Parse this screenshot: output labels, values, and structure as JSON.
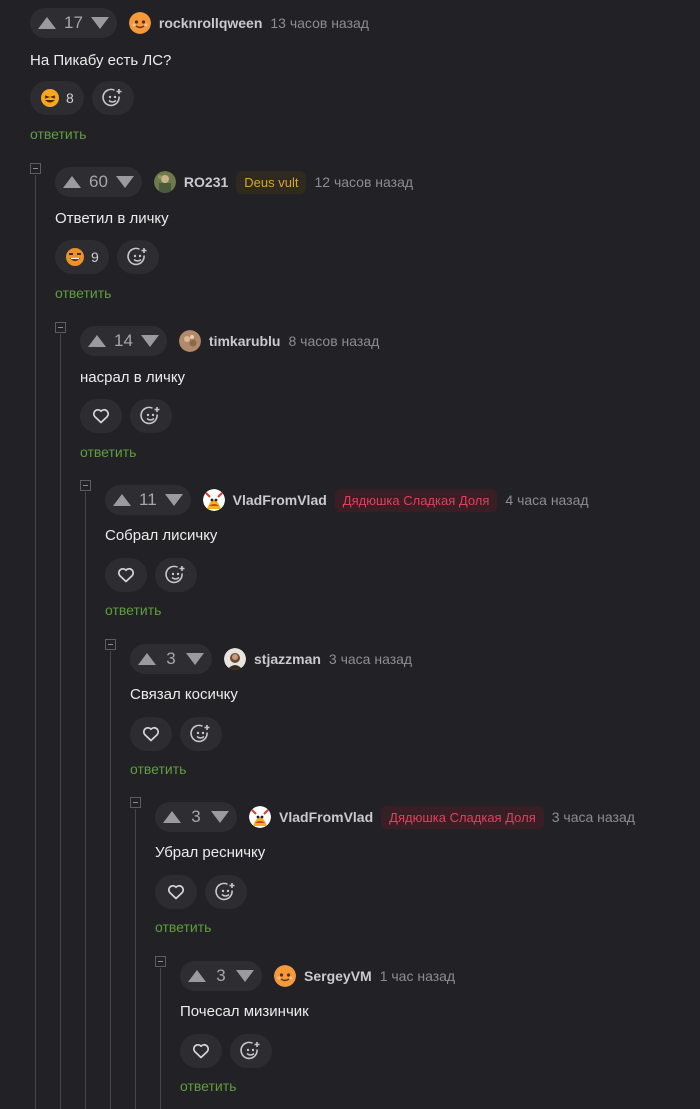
{
  "reply_label": "ответить",
  "colors": {
    "background": "#222226",
    "reply_link": "#5f9e3f",
    "badge_gold": "#d8a72c",
    "badge_red": "#e0405b"
  },
  "comments": [
    {
      "rating": "17",
      "username": "rocknrollqween",
      "badge": "",
      "time": "13 часов назад",
      "text": "На Пикабу есть ЛС?",
      "reaction": {
        "icon": "laughing-emoji-icon",
        "count": "8"
      },
      "avatar_icon": "peach-face-avatar"
    },
    {
      "rating": "60",
      "username": "RO231",
      "badge": "Deus vult",
      "time": "12 часов назад",
      "text": "Ответил в личку",
      "reaction": {
        "icon": "grinning-emoji-icon",
        "count": "9"
      },
      "avatar_icon": "photo-avatar"
    },
    {
      "rating": "14",
      "username": "timkarublu",
      "badge": "",
      "time": "8 часов назад",
      "text": "насрал в личку",
      "reaction": {
        "icon": "heart-icon",
        "count": ""
      },
      "avatar_icon": "photo-avatar"
    },
    {
      "rating": "11",
      "username": "VladFromVlad",
      "badge": "Дядюшка Сладкая Доля",
      "time": "4 часа назад",
      "text": "Собрал лисичку",
      "reaction": {
        "icon": "heart-icon",
        "count": ""
      },
      "avatar_icon": "mascot-avatar"
    },
    {
      "rating": "3",
      "username": "stjazzman",
      "badge": "",
      "time": "3 часа назад",
      "text": "Связал косичку",
      "reaction": {
        "icon": "heart-icon",
        "count": ""
      },
      "avatar_icon": "photo-avatar"
    },
    {
      "rating": "3",
      "username": "VladFromVlad",
      "badge": "Дядюшка Сладкая Доля",
      "time": "3 часа назад",
      "text": "Убрал ресничку",
      "reaction": {
        "icon": "heart-icon",
        "count": ""
      },
      "avatar_icon": "mascot-avatar"
    },
    {
      "rating": "3",
      "username": "SergeyVM",
      "badge": "",
      "time": "1 час назад",
      "text": "Почесал мизинчик",
      "reaction": {
        "icon": "heart-icon",
        "count": ""
      },
      "avatar_icon": "peach-face-avatar"
    }
  ]
}
